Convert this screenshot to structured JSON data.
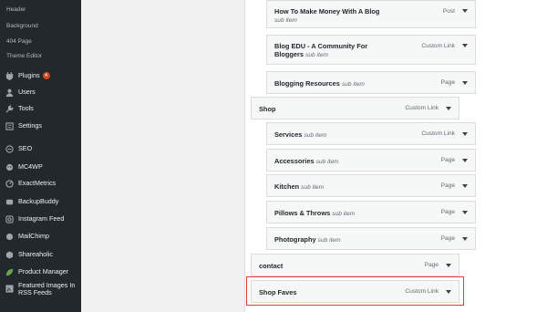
{
  "sidebar": {
    "submenu": [
      "Header",
      "Background",
      "404 Page",
      "Theme Editor"
    ],
    "plugins": {
      "label": "Plugins",
      "badge": "4"
    },
    "users": "Users",
    "tools": "Tools",
    "settings": "Settings",
    "seo": "SEO",
    "mc4wp": "MC4WP",
    "exactmetrics": "ExactMetrics",
    "backupbuddy": "BackupBuddy",
    "instagram": "Instagram Feed",
    "mailchimp": "MailChimp",
    "shareaholic": "Shareaholic",
    "product_manager": "Product Manager",
    "featured_images": {
      "line1": "Featured Images In",
      "line2": "RSS Feeds"
    }
  },
  "menu": {
    "sub_item_label": "sub item",
    "items": [
      {
        "title": "How To Make Money With A Blog",
        "type": "Post"
      },
      {
        "title": "Blog EDU - A Community For",
        "title2": "Bloggers",
        "type": "Custom Link"
      },
      {
        "title": "Blogging Resources",
        "type": "Page"
      },
      {
        "title": "Shop",
        "type": "Custom Link"
      },
      {
        "title": "Services",
        "type": "Custom Link"
      },
      {
        "title": "Accessories",
        "type": "Page"
      },
      {
        "title": "Kitchen",
        "type": "Page"
      },
      {
        "title": "Pillows & Throws",
        "type": "Page"
      },
      {
        "title": "Photography",
        "type": "Page"
      },
      {
        "title": "contact",
        "type": "Page"
      },
      {
        "title": "Shop Faves",
        "type": "Custom Link"
      }
    ]
  },
  "colors": {
    "sidebar_bg": "#23282d",
    "badge": "#ca4a1f",
    "highlight": "#e23b3b"
  }
}
